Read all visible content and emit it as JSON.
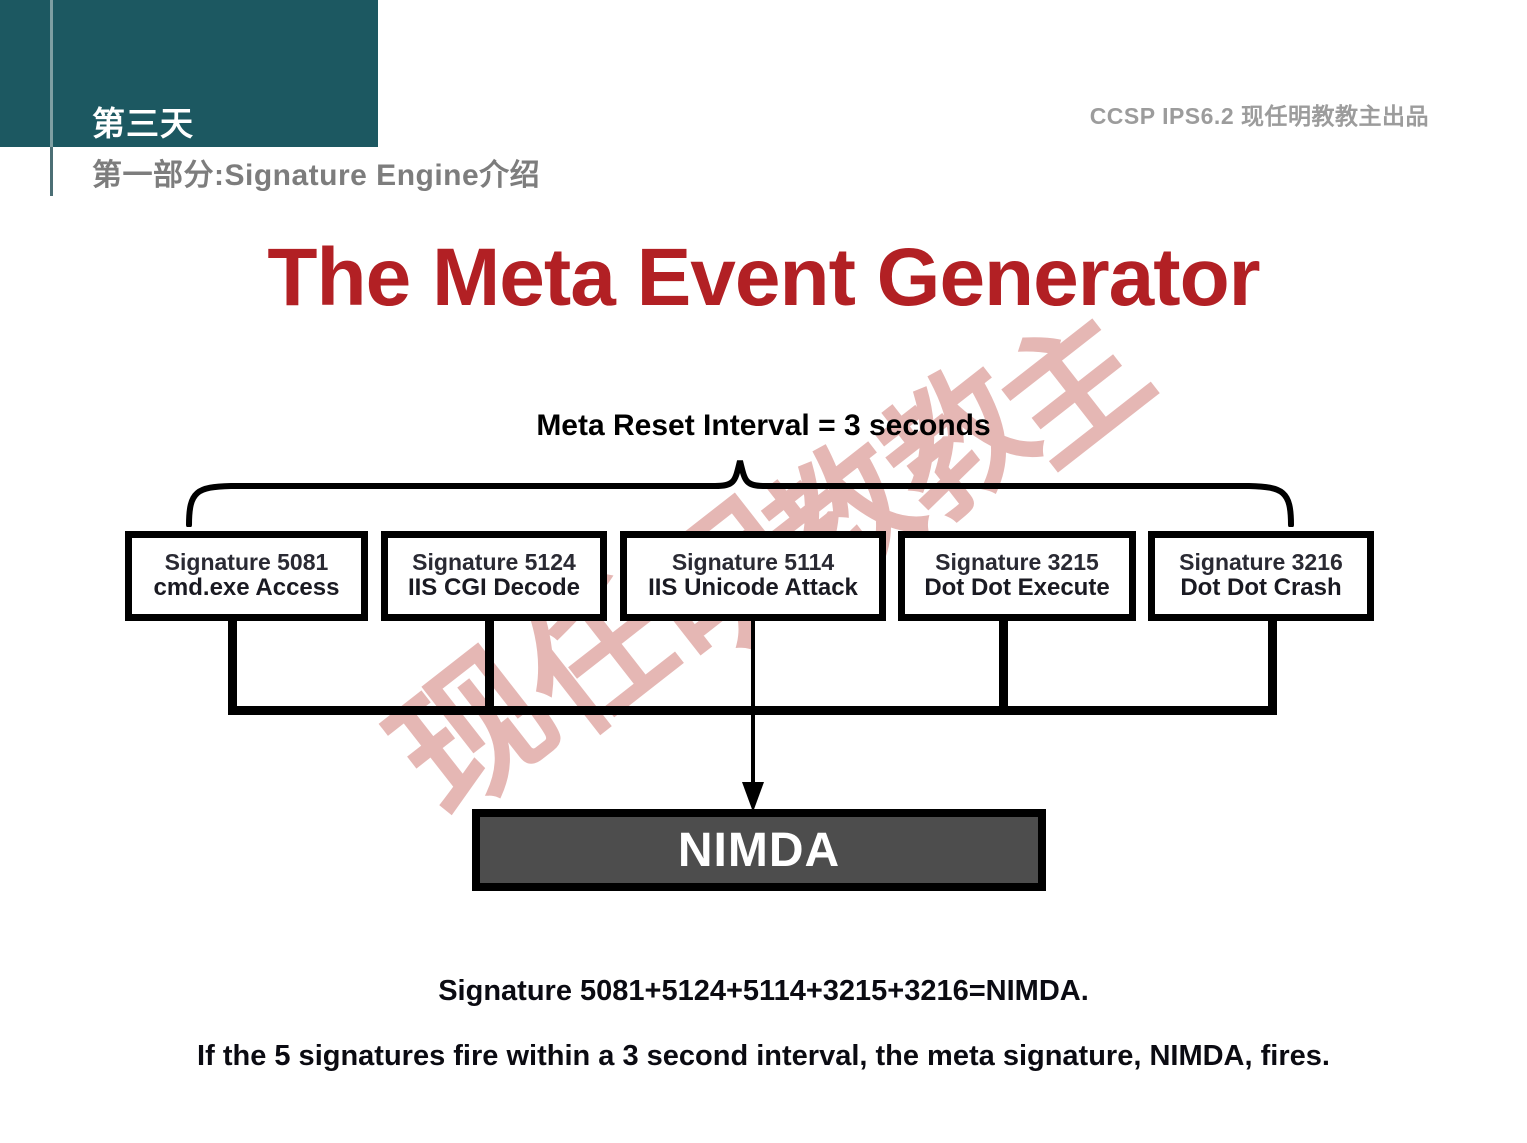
{
  "header": {
    "day_label": "第三天",
    "subtitle": "第一部分:Signature Engine介绍",
    "corner_note": "CCSP IPS6.2  现任明教教主出品"
  },
  "title": "The Meta Event Generator",
  "watermark": {
    "text": "现任明教教主",
    "chars": [
      "现",
      "任",
      "明",
      "教",
      "教",
      "主"
    ],
    "color": "#e4b4b1"
  },
  "diagram": {
    "interval_label": "Meta Reset Interval = 3 seconds",
    "signatures": [
      {
        "id": "Signature 5081",
        "name": "cmd.exe Access"
      },
      {
        "id": "Signature 5124",
        "name": "IIS CGI Decode"
      },
      {
        "id": "Signature 5114",
        "name": "IIS Unicode Attack"
      },
      {
        "id": "Signature 3215",
        "name": "Dot Dot Execute"
      },
      {
        "id": "Signature 3216",
        "name": "Dot Dot Crash"
      }
    ],
    "result_label": "NIMDA",
    "colors": {
      "title": "#b22024",
      "teal": "#1c5861",
      "result_fill": "#4d4d4d",
      "line": "#000000"
    }
  },
  "captions": {
    "line1": "Signature 5081+5124+5114+3215+3216=NIMDA.",
    "line2": "If the 5 signatures fire within a 3 second interval, the meta signature, NIMDA, fires."
  }
}
